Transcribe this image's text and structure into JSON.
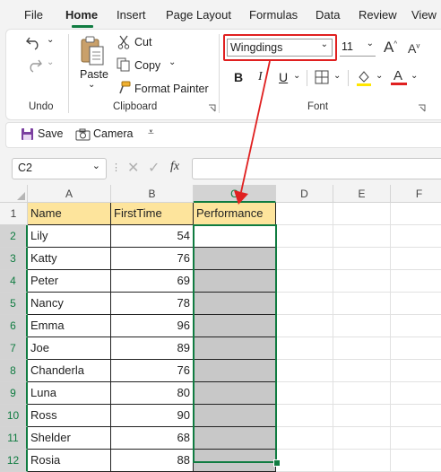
{
  "menu": {
    "tabs": [
      "File",
      "Home",
      "Insert",
      "Page Layout",
      "Formulas",
      "Data",
      "Review",
      "View"
    ],
    "active": "Home"
  },
  "ribbon": {
    "undo_group": "Undo",
    "clipboard": {
      "paste": "Paste",
      "cut": "Cut",
      "copy": "Copy",
      "format_painter": "Format Painter",
      "label": "Clipboard"
    },
    "font": {
      "name": "Wingdings",
      "size": "11",
      "label": "Font",
      "bold": "B",
      "italic": "I",
      "underline": "U",
      "font_color_letter": "A",
      "grow_letter": "A",
      "shrink_letter": "A"
    }
  },
  "quick_access": {
    "save": "Save",
    "camera": "Camera"
  },
  "formula_bar": {
    "name_box": "C2",
    "fx": "fx",
    "value": ""
  },
  "grid": {
    "columns": [
      "A",
      "B",
      "C",
      "D",
      "E",
      "F"
    ],
    "rows": [
      "1",
      "2",
      "3",
      "4",
      "5",
      "6",
      "7",
      "8",
      "9",
      "10",
      "11",
      "12"
    ],
    "headers": [
      "Name",
      "FirstTime",
      "Performance"
    ],
    "data": [
      {
        "name": "Lily",
        "first_time": "54"
      },
      {
        "name": "Katty",
        "first_time": "76"
      },
      {
        "name": "Peter",
        "first_time": "69"
      },
      {
        "name": "Nancy",
        "first_time": "78"
      },
      {
        "name": "Emma",
        "first_time": "96"
      },
      {
        "name": "Joe",
        "first_time": "89"
      },
      {
        "name": "Chanderla",
        "first_time": "76"
      },
      {
        "name": "Luna",
        "first_time": "80"
      },
      {
        "name": "Ross",
        "first_time": "90"
      },
      {
        "name": "Shelder",
        "first_time": "68"
      },
      {
        "name": "Rosia",
        "first_time": "88"
      }
    ]
  },
  "colors": {
    "accent": "#107c41",
    "annotation": "#e02020",
    "header_fill": "#fde49c",
    "selection_fill": "#c8c8c8"
  }
}
